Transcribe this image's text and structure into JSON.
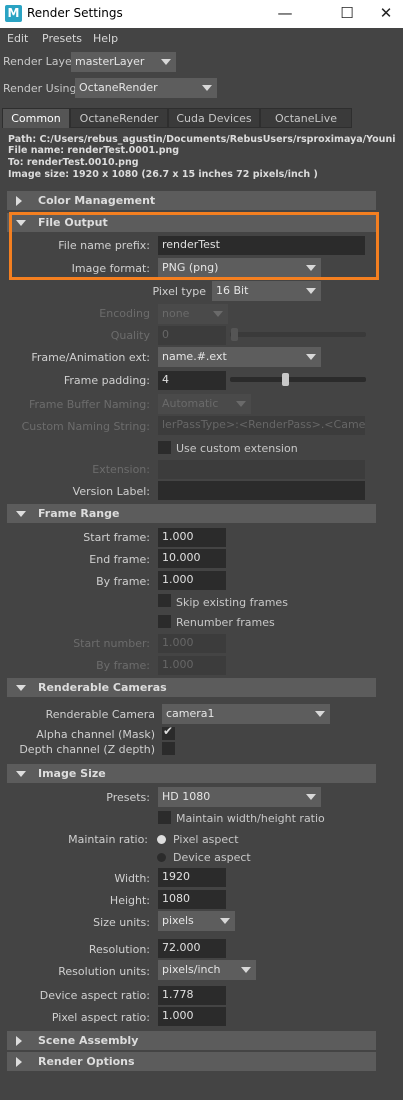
{
  "window": {
    "title": "Render Settings",
    "minimize": "—",
    "maximize": "☐",
    "close": "✕"
  },
  "menu": [
    "Edit",
    "Presets",
    "Help"
  ],
  "render_layer": {
    "label": "Render Layer",
    "value": "masterLayer"
  },
  "render_using": {
    "label": "Render Using",
    "value": "OctaneRender"
  },
  "tabs": [
    "Common",
    "OctaneRender",
    "Cuda Devices",
    "OctaneLive"
  ],
  "info": {
    "path": "Path: C:/Users/rebus_agustin/Documents/RebusUsers/rsproximaya/Youniverse/images/",
    "file_name": "File name:  renderTest.0001.png",
    "to": "To:            renderTest.0010.png",
    "image_size": "Image size: 1920 x 1080 (26.7 x 15 inches 72 pixels/inch )"
  },
  "sections": {
    "color_management": "Color Management",
    "file_output": "File Output",
    "frame_range": "Frame Range",
    "renderable_cameras": "Renderable Cameras",
    "image_size": "Image Size",
    "scene_assembly": "Scene Assembly",
    "render_options": "Render Options"
  },
  "file_output": {
    "prefix_label": "File name prefix:",
    "prefix_value": "renderTest",
    "format_label": "Image format:",
    "format_value": "PNG (png)",
    "pixel_type_label": "Pixel type",
    "pixel_type_value": "16 Bit",
    "encoding_label": "Encoding",
    "encoding_value": "none",
    "quality_label": "Quality",
    "quality_value": "0",
    "ext_label": "Frame/Animation ext:",
    "ext_value": "name.#.ext",
    "padding_label": "Frame padding:",
    "padding_value": "4",
    "fb_naming_label": "Frame Buffer Naming:",
    "fb_naming_value": "Automatic",
    "custom_naming_label": "Custom Naming String:",
    "custom_naming_value": "lerPassType>:<RenderPass>.<Camera>",
    "use_custom_ext_label": "Use custom extension",
    "extension_label": "Extension:",
    "version_label": "Version Label:"
  },
  "frame_range": {
    "start_label": "Start frame:",
    "start_value": "1.000",
    "end_label": "End frame:",
    "end_value": "10.000",
    "by_label": "By frame:",
    "by_value": "1.000",
    "skip_label": "Skip existing frames",
    "renumber_label": "Renumber frames",
    "start_number_label": "Start number:",
    "start_number_value": "1.000",
    "by_frame2_label": "By frame:",
    "by_frame2_value": "1.000"
  },
  "cameras": {
    "camera_label": "Renderable Camera",
    "camera_value": "camera1",
    "alpha_label": "Alpha channel (Mask)",
    "depth_label": "Depth channel (Z depth)"
  },
  "image_size": {
    "presets_label": "Presets:",
    "presets_value": "HD 1080",
    "maintain_wh_label": "Maintain width/height ratio",
    "maintain_ratio_label": "Maintain ratio:",
    "pixel_aspect_label": "Pixel aspect",
    "device_aspect_label": "Device aspect",
    "width_label": "Width:",
    "width_value": "1920",
    "height_label": "Height:",
    "height_value": "1080",
    "size_units_label": "Size units:",
    "size_units_value": "pixels",
    "resolution_label": "Resolution:",
    "resolution_value": "72.000",
    "res_units_label": "Resolution units:",
    "res_units_value": "pixels/inch",
    "device_ar_label": "Device aspect ratio:",
    "device_ar_value": "1.778",
    "pixel_ar_label": "Pixel aspect ratio:",
    "pixel_ar_value": "1.000"
  },
  "colors": {
    "highlight": "#f47f20",
    "background": "#444444",
    "section": "#5c5c5c",
    "field": "#2b2b2b"
  }
}
